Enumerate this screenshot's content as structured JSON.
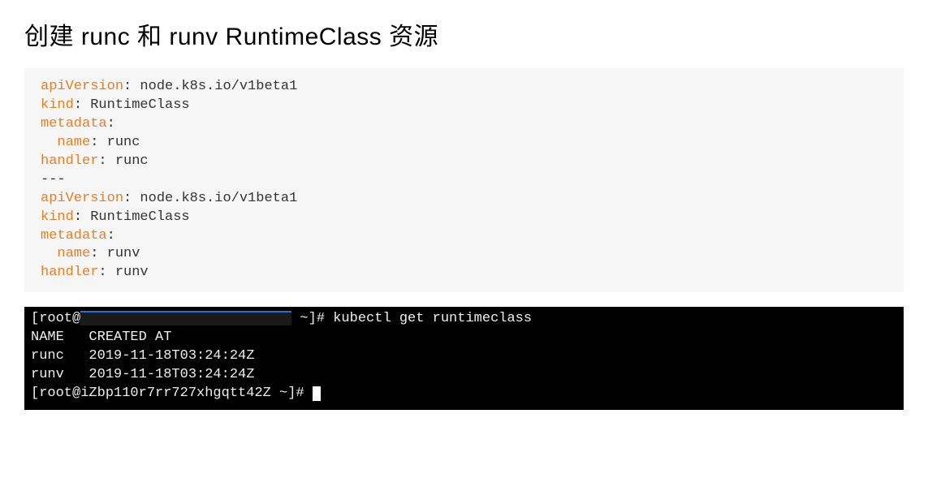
{
  "title": "创建 runc 和 runv RuntimeClass 资源",
  "yaml": {
    "lines": [
      {
        "key": "apiVersion",
        "val": "node.k8s.io/v1beta1",
        "indent": 0
      },
      {
        "key": "kind",
        "val": "RuntimeClass",
        "indent": 0
      },
      {
        "key": "metadata",
        "val": "",
        "indent": 0
      },
      {
        "key": "name",
        "val": "runc",
        "indent": 1
      },
      {
        "key": "handler",
        "val": "runc",
        "indent": 0
      },
      {
        "sep": "---"
      },
      {
        "key": "apiVersion",
        "val": "node.k8s.io/v1beta1",
        "indent": 0
      },
      {
        "key": "kind",
        "val": "RuntimeClass",
        "indent": 0
      },
      {
        "key": "metadata",
        "val": "",
        "indent": 0
      },
      {
        "key": "name",
        "val": "runv",
        "indent": 1
      },
      {
        "key": "handler",
        "val": "runv",
        "indent": 0
      }
    ]
  },
  "terminal": {
    "prompt1_pre": "[root@",
    "prompt1_post": " ~]# ",
    "cmd1": "kubectl get runtimeclass",
    "header": "NAME   CREATED AT",
    "rows": [
      {
        "name": "runc",
        "created": "2019-11-18T03:24:24Z"
      },
      {
        "name": "runv",
        "created": "2019-11-18T03:24:24Z"
      }
    ],
    "prompt2": "[root@iZbp110r7rr727xhgqtt42Z ~]# "
  }
}
